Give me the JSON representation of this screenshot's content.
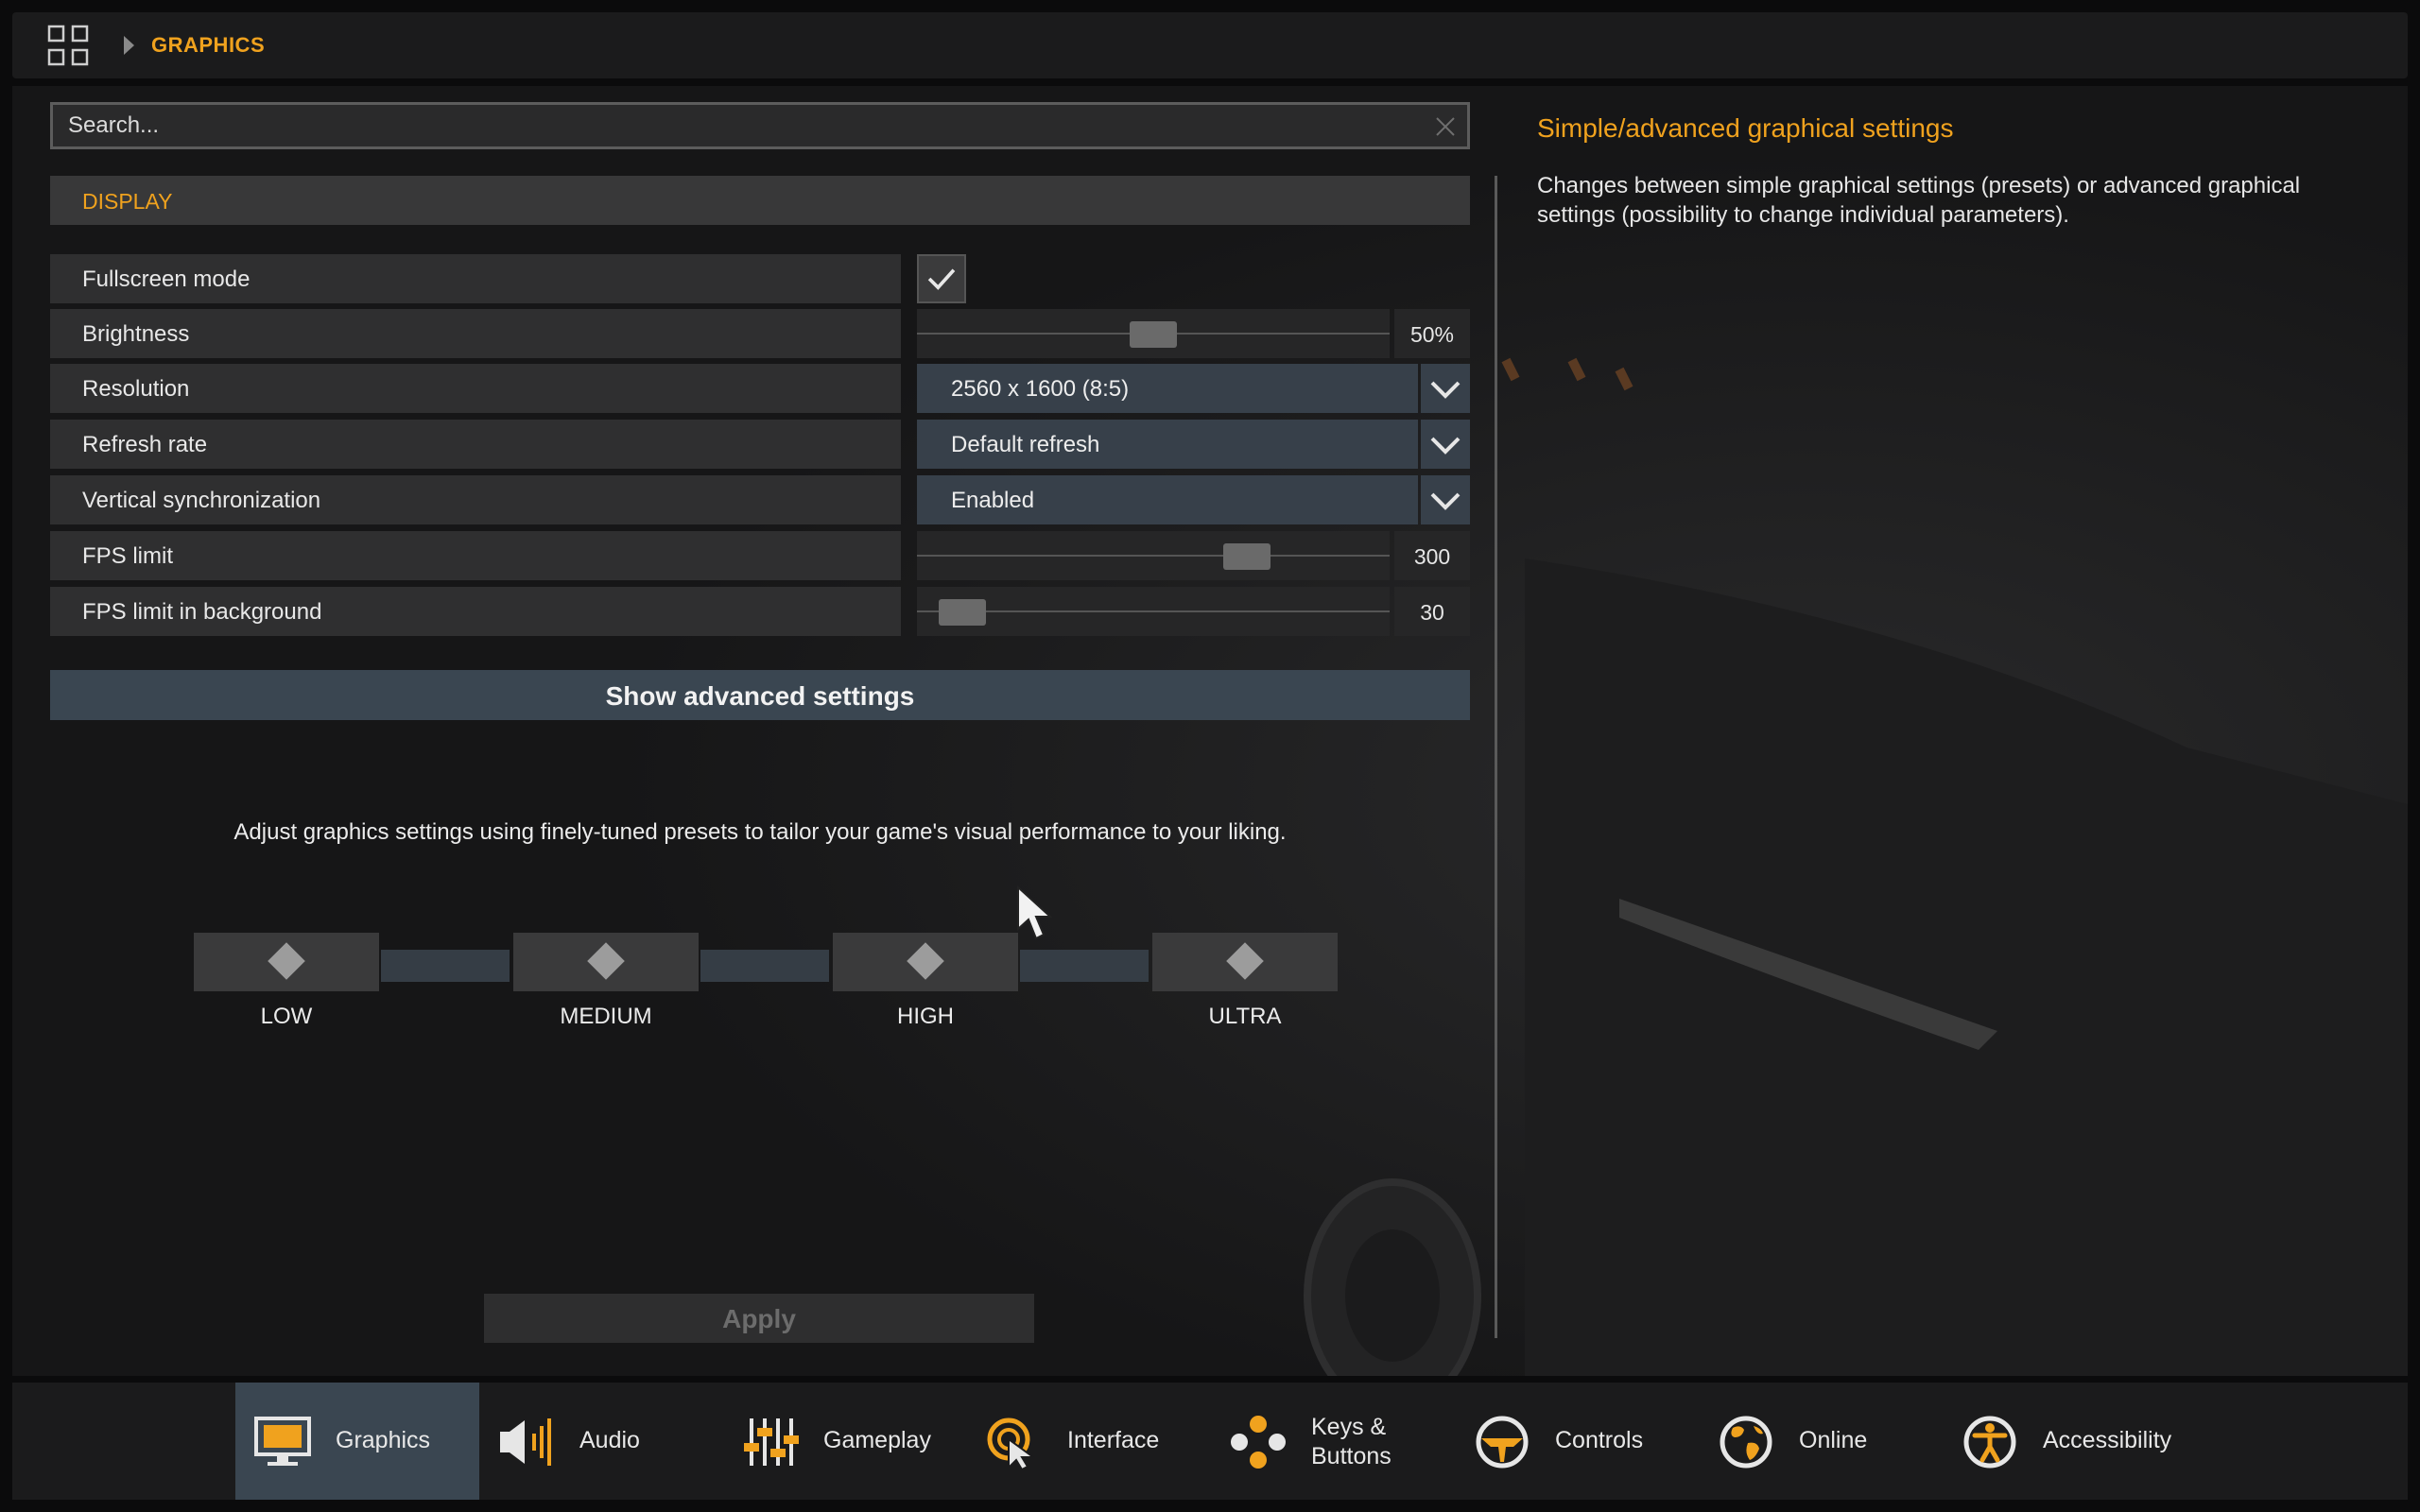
{
  "breadcrumb": {
    "current": "GRAPHICS"
  },
  "search": {
    "placeholder": "Search..."
  },
  "section": {
    "title": "DISPLAY"
  },
  "settings": {
    "fullscreen": {
      "label": "Fullscreen mode",
      "checked": true
    },
    "brightness": {
      "label": "Brightness",
      "value": "50%",
      "level": 0.5
    },
    "resolution": {
      "label": "Resolution",
      "value": "2560 x 1600 (8:5)"
    },
    "refresh_rate": {
      "label": "Refresh rate",
      "value": "Default refresh"
    },
    "vsync": {
      "label": "Vertical synchronization",
      "value": "Enabled"
    },
    "fps_limit": {
      "label": "FPS limit",
      "value": "300",
      "level": 0.72
    },
    "fps_bg": {
      "label": "FPS limit in background",
      "value": "30",
      "level": 0.05
    }
  },
  "advanced_button": "Show advanced settings",
  "presets": {
    "description": "Adjust graphics settings using finely-tuned presets to tailor your game's visual performance to your liking.",
    "items": [
      "LOW",
      "MEDIUM",
      "HIGH",
      "ULTRA"
    ]
  },
  "apply_label": "Apply",
  "help": {
    "title": "Simple/advanced graphical settings",
    "text": "Changes between simple graphical settings (presets) or advanced graphical settings (possibility to change individual parameters)."
  },
  "nav": {
    "active": "Graphics",
    "items": [
      {
        "label": "Graphics",
        "icon": "monitor-icon"
      },
      {
        "label": "Audio",
        "icon": "speaker-icon"
      },
      {
        "label": "Gameplay",
        "icon": "sliders-icon"
      },
      {
        "label": "Interface",
        "icon": "pointer-icon"
      },
      {
        "label": "Keys & Buttons",
        "icon": "gamepad-buttons-icon"
      },
      {
        "label": "Controls",
        "icon": "steering-wheel-icon"
      },
      {
        "label": "Online",
        "icon": "globe-icon"
      },
      {
        "label": "Accessibility",
        "icon": "accessibility-icon"
      }
    ]
  },
  "colors": {
    "accent": "#f0a21e",
    "selected": "#3a4651"
  }
}
